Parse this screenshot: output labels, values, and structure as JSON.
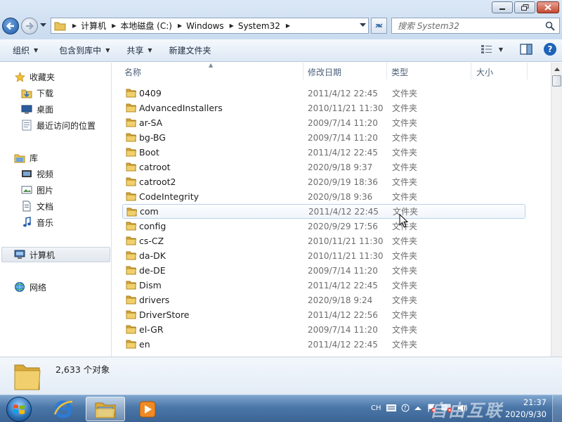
{
  "window": {
    "address": {
      "crumbs": [
        "计算机",
        "本地磁盘 (C:)",
        "Windows",
        "System32"
      ]
    },
    "search": {
      "placeholder": "搜索 System32"
    }
  },
  "toolbar": {
    "organize": "组织",
    "include_in_library": "包含到库中",
    "share": "共享",
    "new_folder": "新建文件夹"
  },
  "navpane": {
    "favorites": "收藏夹",
    "downloads": "下载",
    "desktop": "桌面",
    "recent": "最近访问的位置",
    "libraries": "库",
    "videos": "视频",
    "pictures": "图片",
    "documents": "文档",
    "music": "音乐",
    "computer": "计算机",
    "network": "网络"
  },
  "columns": {
    "name": "名称",
    "date": "修改日期",
    "type": "类型",
    "size": "大小"
  },
  "files": [
    {
      "name": "0409",
      "date": "2011/4/12 22:45",
      "type": "文件夹"
    },
    {
      "name": "AdvancedInstallers",
      "date": "2010/11/21 11:30",
      "type": "文件夹"
    },
    {
      "name": "ar-SA",
      "date": "2009/7/14 11:20",
      "type": "文件夹"
    },
    {
      "name": "bg-BG",
      "date": "2009/7/14 11:20",
      "type": "文件夹"
    },
    {
      "name": "Boot",
      "date": "2011/4/12 22:45",
      "type": "文件夹"
    },
    {
      "name": "catroot",
      "date": "2020/9/18 9:37",
      "type": "文件夹"
    },
    {
      "name": "catroot2",
      "date": "2020/9/19 18:36",
      "type": "文件夹"
    },
    {
      "name": "CodeIntegrity",
      "date": "2020/9/18 9:36",
      "type": "文件夹"
    },
    {
      "name": "com",
      "date": "2011/4/12 22:45",
      "type": "文件夹"
    },
    {
      "name": "config",
      "date": "2020/9/29 17:56",
      "type": "文件夹"
    },
    {
      "name": "cs-CZ",
      "date": "2010/11/21 11:30",
      "type": "文件夹"
    },
    {
      "name": "da-DK",
      "date": "2010/11/21 11:30",
      "type": "文件夹"
    },
    {
      "name": "de-DE",
      "date": "2009/7/14 11:20",
      "type": "文件夹"
    },
    {
      "name": "Dism",
      "date": "2011/4/12 22:45",
      "type": "文件夹"
    },
    {
      "name": "drivers",
      "date": "2020/9/18 9:24",
      "type": "文件夹"
    },
    {
      "name": "DriverStore",
      "date": "2011/4/12 22:56",
      "type": "文件夹"
    },
    {
      "name": "el-GR",
      "date": "2009/7/14 11:20",
      "type": "文件夹"
    },
    {
      "name": "en",
      "date": "2011/4/12 22:45",
      "type": "文件夹"
    }
  ],
  "hovered_file": "com",
  "details": {
    "count": "2,633 个对象"
  },
  "taskbar": {
    "lang": "CH",
    "time": "21:37",
    "date": "2020/9/30"
  },
  "watermark": "自由互联"
}
